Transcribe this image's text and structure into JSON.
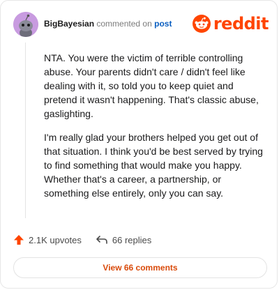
{
  "header": {
    "author": "BigBayesian",
    "action_text": "commented on",
    "post_link": "post",
    "logo_text": "reddit"
  },
  "comment": {
    "paragraphs": [
      "NTA. You were the victim of terrible controlling abuse. Your parents didn't care / didn't feel like dealing with it, so told you to keep quiet and pretend it wasn't happening. That's classic abuse, gaslighting.",
      "I'm really glad your brothers helped you get out of that situation. I think you'd be best served by trying to find something that would make you happy. Whether that's a career, a partnership, or something else entirely, only you can say."
    ]
  },
  "actions": {
    "upvotes": "2.1K upvotes",
    "replies": "66 replies"
  },
  "view_button": "View 66 comments",
  "colors": {
    "brand": "#ff4500",
    "link": "#0b5fc1",
    "avatar_bg": "#c89be0"
  }
}
